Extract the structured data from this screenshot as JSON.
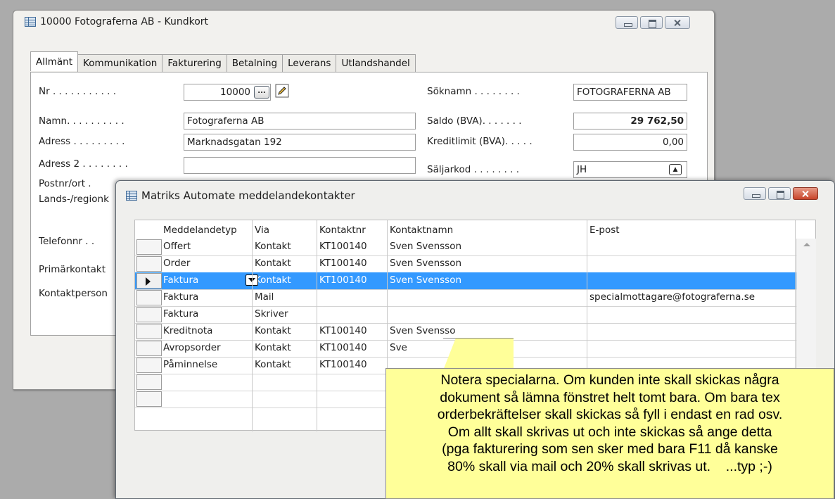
{
  "window_main": {
    "title": "10000 Fotograferna AB - Kundkort",
    "tabs": [
      "Allmänt",
      "Kommunikation",
      "Fakturering",
      "Betalning",
      "Leverans",
      "Utlandshandel"
    ],
    "fields_left": [
      {
        "label": "Nr . . . . . . . . . . .",
        "value": "10000"
      },
      {
        "label": "Namn. . . . . . . . . .",
        "value": "Fotograferna AB"
      },
      {
        "label": "Adress . . . . . . . . .",
        "value": "Marknadsgatan 192"
      },
      {
        "label": "Adress 2 . . . . . . . .",
        "value": ""
      }
    ],
    "labels_hidden": [
      "Postnr/ort .",
      "Lands-/regionk",
      "Telefonnr . .",
      "Primärkontakt",
      "Kontaktperson"
    ],
    "fields_right": [
      {
        "label": "Söknamn . . . . . . . .",
        "value": "FOTOGRAFERNA AB"
      },
      {
        "label": "Saldo (BVA). . . . . . .",
        "value": "29 762,50"
      },
      {
        "label": "Kreditlimit (BVA). . . . .",
        "value": "0,00"
      },
      {
        "label": "Säljarkod . . . . . . . .",
        "value": "JH"
      }
    ],
    "lookup_label": "...",
    "up_label": "▲"
  },
  "window_matrix": {
    "title": "Matriks Automate meddelandekontakter",
    "columns": [
      "Meddelandetyp",
      "Via",
      "Kontaktnr",
      "Kontaktnamn",
      "E-post"
    ],
    "rows": [
      {
        "typ": "Offert",
        "via": "Kontakt",
        "nr": "KT100140",
        "namn": "Sven Svensson",
        "epost": ""
      },
      {
        "typ": "Order",
        "via": "Kontakt",
        "nr": "KT100140",
        "namn": "Sven Svensson",
        "epost": ""
      },
      {
        "typ": "Faktura",
        "via": "Kontakt",
        "nr": "KT100140",
        "namn": "Sven Svensson",
        "epost": ""
      },
      {
        "typ": "Faktura",
        "via": "Mail",
        "nr": "",
        "namn": "",
        "epost": "specialmottagare@fotograferna.se"
      },
      {
        "typ": "Faktura",
        "via": "Skriver",
        "nr": "",
        "namn": "",
        "epost": ""
      },
      {
        "typ": "Kreditnota",
        "via": "Kontakt",
        "nr": "KT100140",
        "namn": "Sven Svensso",
        "epost": ""
      },
      {
        "typ": "Avropsorder",
        "via": "Kontakt",
        "nr": "KT100140",
        "namn": "Sve",
        "epost": ""
      },
      {
        "typ": "Påminnelse",
        "via": "Kontakt",
        "nr": "KT100140",
        "namn": "",
        "epost": ""
      },
      {
        "typ": "",
        "via": "",
        "nr": "",
        "namn": "",
        "epost": ""
      },
      {
        "typ": "",
        "via": "",
        "nr": "",
        "namn": "",
        "epost": ""
      }
    ],
    "selected_row": 2
  },
  "note": {
    "lines": [
      "Notera specialarna. Om kunden inte skall skickas några",
      "dokument så lämna fönstret helt tomt bara. Om bara tex",
      "orderbekräftelser skall skickas så fyll i endast en rad osv.",
      "Om allt skall skrivas ut och inte skickas så ange detta",
      "(pga fakturering som sen sker med bara F11 då kanske",
      "80% skall via mail och 20% skall skrivas ut.    ...typ ;-)"
    ]
  },
  "colors": {
    "selection": "#3399ff",
    "note_background": "#ffff99",
    "close_button": "#c8452b"
  }
}
